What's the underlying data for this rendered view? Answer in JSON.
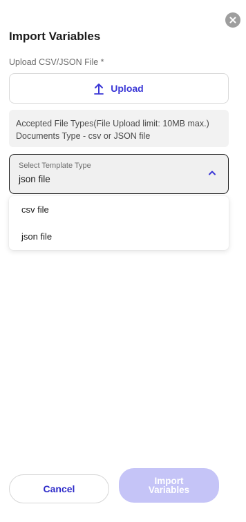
{
  "dialog": {
    "title": "Import Variables",
    "close_icon": "close-icon"
  },
  "upload": {
    "label": "Upload CSV/JSON File *",
    "button_label": "Upload",
    "icon": "upload-arrow-icon"
  },
  "info": {
    "line1": "Accepted File Types(File Upload limit: 10MB max.)",
    "line2": "Documents Type - csv or JSON file"
  },
  "template_select": {
    "label": "Select Template Type",
    "value": "json file",
    "expanded": true,
    "options": [
      "csv file",
      "json file"
    ]
  },
  "footer": {
    "cancel_label": "Cancel",
    "import_label": "Import Variables",
    "import_disabled": true
  },
  "colors": {
    "accent": "#3a37d6",
    "import_disabled_bg": "#c5c4f7",
    "close_bg": "#9e9e9e"
  }
}
